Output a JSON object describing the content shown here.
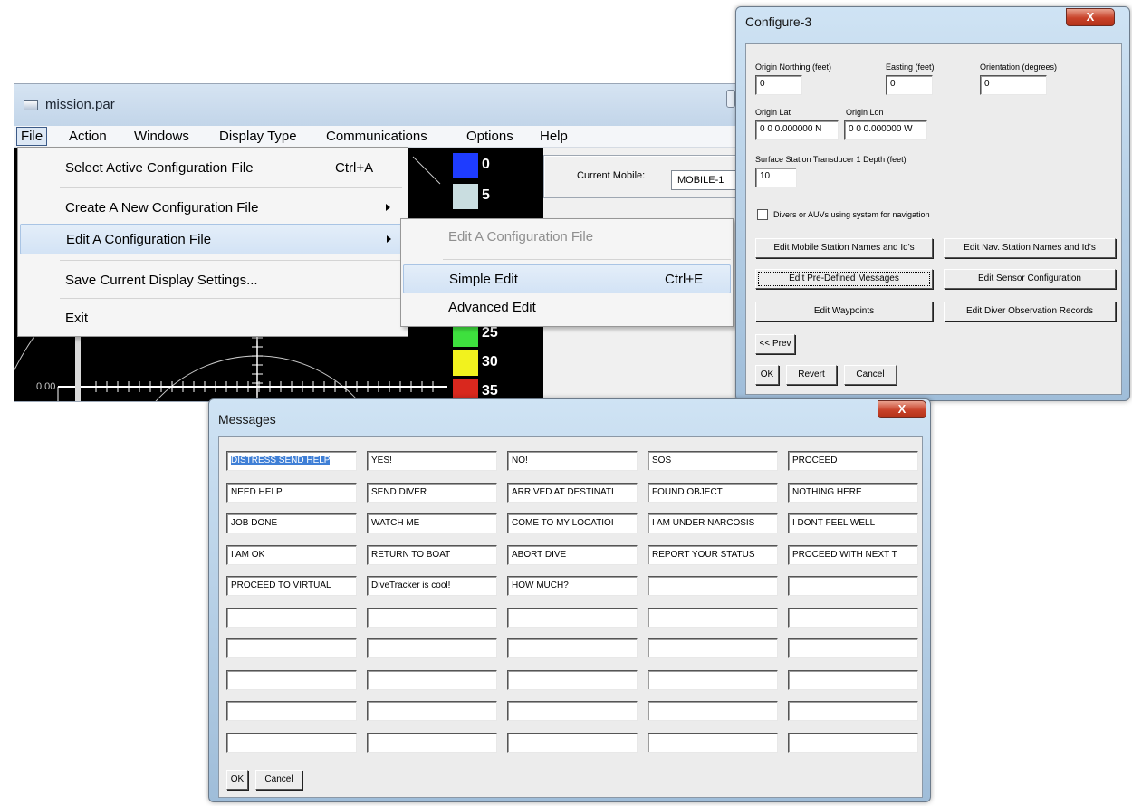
{
  "main_window": {
    "title": "mission.par",
    "menu": [
      "File",
      "Action",
      "Windows",
      "Display Type",
      "Communications",
      "Options",
      "Help"
    ],
    "file_menu": {
      "items": [
        {
          "label": "Select Active Configuration File",
          "shortcut": "Ctrl+A",
          "submenu": false
        },
        {
          "label": "Create A New Configuration File",
          "shortcut": "",
          "submenu": true
        },
        {
          "label": "Edit A Configuration File",
          "shortcut": "",
          "submenu": true
        },
        {
          "label": "Save Current Display Settings...",
          "shortcut": "",
          "submenu": false
        },
        {
          "label": "Exit",
          "shortcut": "",
          "submenu": false
        }
      ],
      "submenu": [
        {
          "label": "Edit A Configuration File",
          "shortcut": "",
          "disabled": true
        },
        {
          "label": "Simple Edit",
          "shortcut": "Ctrl+E",
          "disabled": false
        },
        {
          "label": "Advanced Edit",
          "shortcut": "",
          "disabled": false
        }
      ]
    },
    "scale_label": "0.00",
    "depth_legend": [
      {
        "label": "0",
        "color": "#1e3cff"
      },
      {
        "label": "5",
        "color": "#c9dde0"
      },
      {
        "label": "25",
        "color": "#3ee03e"
      },
      {
        "label": "30",
        "color": "#f2f21e"
      },
      {
        "label": "35",
        "color": "#d9281e"
      }
    ],
    "current_mobile_label": "Current Mobile:",
    "current_mobile_value": "MOBILE-1"
  },
  "configure_dialog": {
    "title": "Configure-3",
    "close_label": "X",
    "origin_northing_label": "Origin Northing (feet)",
    "origin_northing_value": "0",
    "easting_label": "Easting (feet)",
    "easting_value": "0",
    "orientation_label": "Orientation (degrees)",
    "orientation_value": "0",
    "origin_lat_label": "Origin Lat",
    "origin_lat_value": "0 0 0.000000 N",
    "origin_lon_label": "Origin Lon",
    "origin_lon_value": "0 0 0.000000 W",
    "transducer_label": "Surface Station Transducer 1 Depth (feet)",
    "transducer_value": "10",
    "divers_checkbox_label": "Divers or AUVs using system for navigation",
    "divers_checked": false,
    "buttons": {
      "edit_mobile_names": "Edit Mobile Station Names and Id's",
      "edit_nav_names": "Edit Nav. Station Names and Id's",
      "edit_predefined_messages": "Edit Pre-Defined Messages",
      "edit_sensor_config": "Edit Sensor Configuration",
      "edit_waypoints": "Edit Waypoints",
      "edit_diver_obs": "Edit Diver Observation Records",
      "prev": "<< Prev",
      "ok": "OK",
      "revert": "Revert",
      "cancel": "Cancel"
    }
  },
  "messages_dialog": {
    "title": "Messages",
    "close_label": "X",
    "selected": "DISTRESS SEND HELP",
    "grid": [
      [
        "DISTRESS SEND HELP",
        "YES!",
        "NO!",
        "SOS",
        "PROCEED"
      ],
      [
        "NEED HELP",
        "SEND DIVER",
        "ARRIVED AT DESTINATI",
        "FOUND OBJECT",
        "NOTHING HERE"
      ],
      [
        "JOB DONE",
        "WATCH ME",
        "COME TO MY LOCATIOI",
        "I AM UNDER NARCOSIS",
        "I DONT FEEL WELL"
      ],
      [
        "I AM OK",
        "RETURN TO BOAT",
        "ABORT DIVE",
        "REPORT YOUR STATUS",
        "PROCEED WITH NEXT T"
      ],
      [
        "PROCEED TO VIRTUAL",
        "DiveTracker is cool!",
        "HOW MUCH?",
        "",
        ""
      ],
      [
        "",
        "",
        "",
        "",
        ""
      ],
      [
        "",
        "",
        "",
        "",
        ""
      ],
      [
        "",
        "",
        "",
        "",
        ""
      ],
      [
        "",
        "",
        "",
        "",
        ""
      ],
      [
        "",
        "",
        "",
        "",
        ""
      ]
    ],
    "ok_label": "OK",
    "cancel_label": "Cancel"
  }
}
